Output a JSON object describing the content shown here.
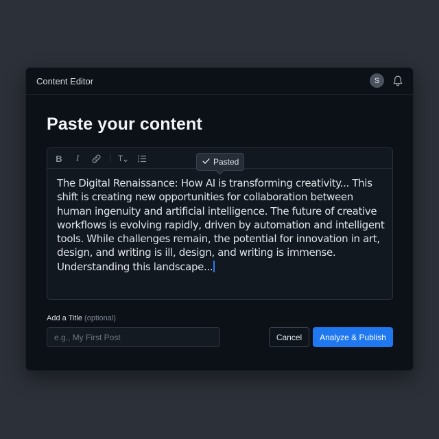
{
  "header": {
    "app_title": "Content Editor",
    "avatar_initial": "S",
    "notification_icon": "bell-icon"
  },
  "main": {
    "heading": "Paste your content"
  },
  "editor": {
    "toolbar": {
      "bold_label": "B",
      "italic_label": "I",
      "link_icon": "link-icon",
      "text_style_label": "T",
      "text_style_icon": "text-size-icon",
      "list_icon": "bullet-list-icon"
    },
    "tooltip": {
      "check_icon": "check-icon",
      "label": "Pasted"
    },
    "content": "The Digital Renaissance: How AI is transforming creativity... This shift is creating new opportunities for collaboration between human ingenuity and artificial intelligence. The future of creative workflows is evolving rapidly, driven by automation and intelligent tools. While challenges remain, the potential for innovation in art, design, and writing is ill, design, and writing is immense. Understanding this landscape..."
  },
  "title_field": {
    "label": "Add a Title",
    "optional_hint": "(optional)",
    "placeholder": "e.g., My First Post",
    "value": ""
  },
  "actions": {
    "cancel_label": "Cancel",
    "publish_label": "Analyze & Publish"
  },
  "colors": {
    "page_background": "#2c3038",
    "window_background": "#0c1118",
    "accent": "#1f78f0",
    "caret": "#2f7cf0"
  }
}
